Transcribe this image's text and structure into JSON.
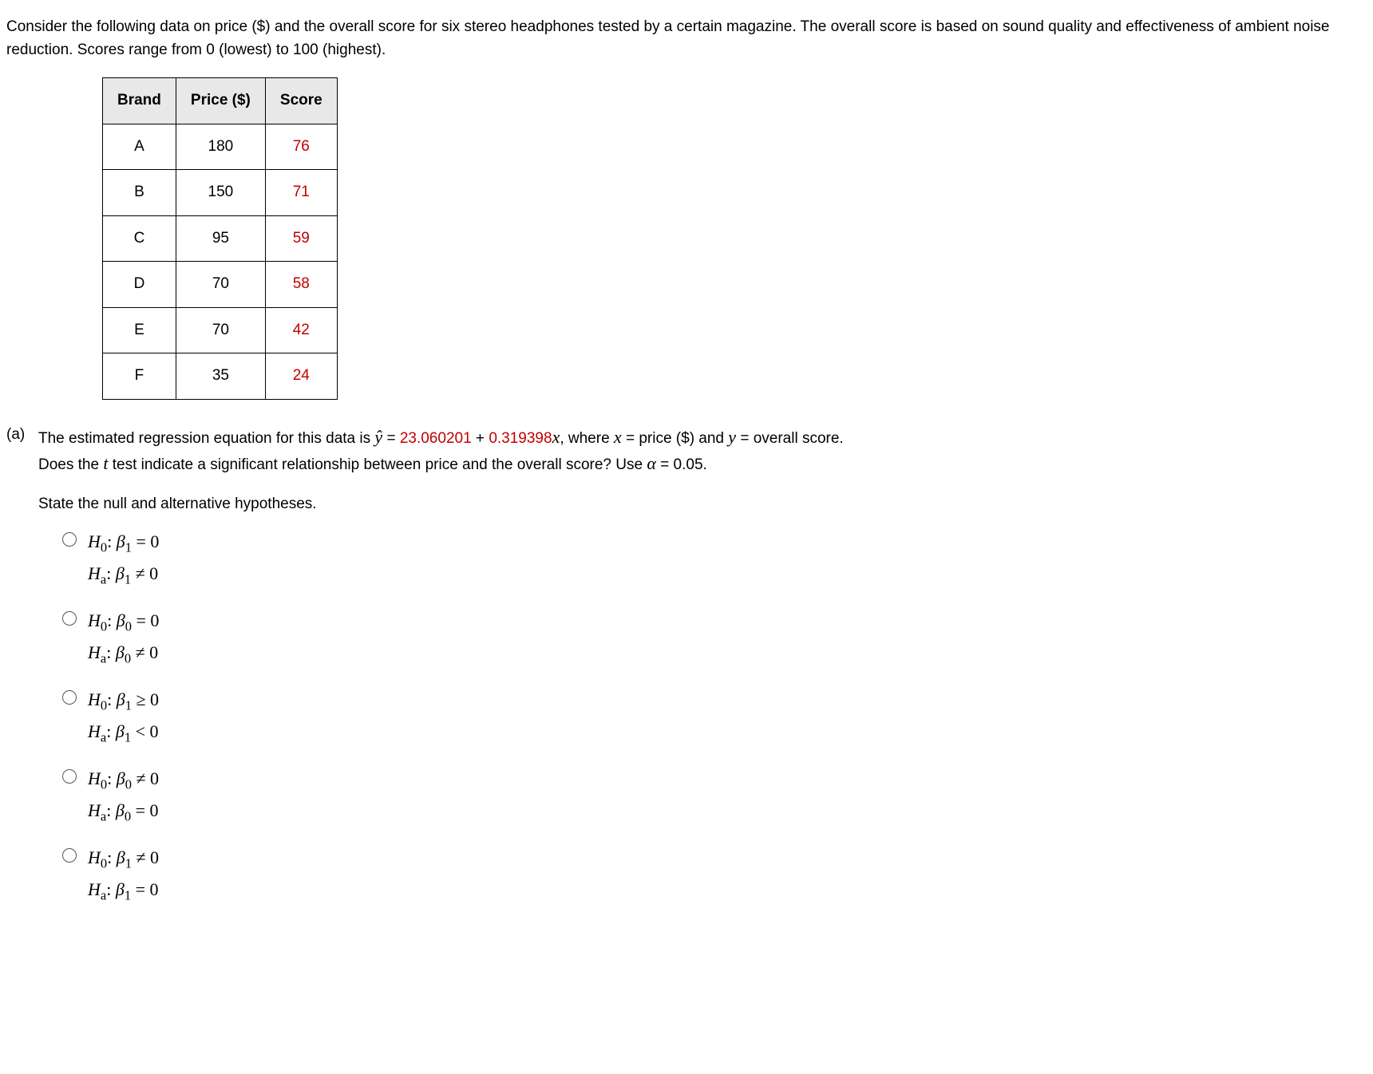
{
  "intro": "Consider the following data on price ($) and the overall score for six stereo headphones tested by a certain magazine. The overall score is based on sound quality and effectiveness of ambient noise reduction. Scores range from 0 (lowest) to 100 (highest).",
  "table": {
    "headers": {
      "c0": "Brand",
      "c1": "Price ($)",
      "c2": "Score"
    },
    "rows": [
      {
        "brand": "A",
        "price": "180",
        "score": "76"
      },
      {
        "brand": "B",
        "price": "150",
        "score": "71"
      },
      {
        "brand": "C",
        "price": "95",
        "score": "59"
      },
      {
        "brand": "D",
        "price": "70",
        "score": "58"
      },
      {
        "brand": "E",
        "price": "70",
        "score": "42"
      },
      {
        "brand": "F",
        "price": "35",
        "score": "24"
      }
    ]
  },
  "part_a": {
    "label": "(a)",
    "eq_pre": "The estimated regression equation for this data is ",
    "yhat": "ŷ",
    "eq_mid": " = ",
    "eq_b0": "23.060201",
    "eq_plus": " + ",
    "eq_b1": "0.319398",
    "eq_x": "x",
    "eq_post1": ", where ",
    "eq_xdef_x": "x",
    "eq_xdef_txt": " = price ($) and ",
    "eq_ydef_y": "y",
    "eq_ydef_txt": " = overall score.",
    "q_line2a": "Does the ",
    "q_line2_t": "t",
    "q_line2b": " test indicate a significant relationship between price and the overall score? Use ",
    "alpha": "α",
    "alpha_val": " = 0.05."
  },
  "state_prompt": "State the null and alternative hypotheses.",
  "opts": {
    "o1": {
      "h0_label": "H",
      "h0_sub": "0",
      "h0_colon": ": ",
      "h0_beta": "β",
      "h0_bsub": "1",
      "h0_rest": " = 0",
      "ha_label": "H",
      "ha_sub": "a",
      "ha_colon": ": ",
      "ha_beta": "β",
      "ha_bsub": "1",
      "ha_rest": " ≠ 0"
    },
    "o2": {
      "h0_label": "H",
      "h0_sub": "0",
      "h0_colon": ": ",
      "h0_beta": "β",
      "h0_bsub": "0",
      "h0_rest": " = 0",
      "ha_label": "H",
      "ha_sub": "a",
      "ha_colon": ": ",
      "ha_beta": "β",
      "ha_bsub": "0",
      "ha_rest": " ≠ 0"
    },
    "o3": {
      "h0_label": "H",
      "h0_sub": "0",
      "h0_colon": ": ",
      "h0_beta": "β",
      "h0_bsub": "1",
      "h0_rest": " ≥ 0",
      "ha_label": "H",
      "ha_sub": "a",
      "ha_colon": ": ",
      "ha_beta": "β",
      "ha_bsub": "1",
      "ha_rest": " < 0"
    },
    "o4": {
      "h0_label": "H",
      "h0_sub": "0",
      "h0_colon": ": ",
      "h0_beta": "β",
      "h0_bsub": "0",
      "h0_rest": " ≠ 0",
      "ha_label": "H",
      "ha_sub": "a",
      "ha_colon": ": ",
      "ha_beta": "β",
      "ha_bsub": "0",
      "ha_rest": " = 0"
    },
    "o5": {
      "h0_label": "H",
      "h0_sub": "0",
      "h0_colon": ": ",
      "h0_beta": "β",
      "h0_bsub": "1",
      "h0_rest": " ≠ 0",
      "ha_label": "H",
      "ha_sub": "a",
      "ha_colon": ": ",
      "ha_beta": "β",
      "ha_bsub": "1",
      "ha_rest": " = 0"
    }
  }
}
